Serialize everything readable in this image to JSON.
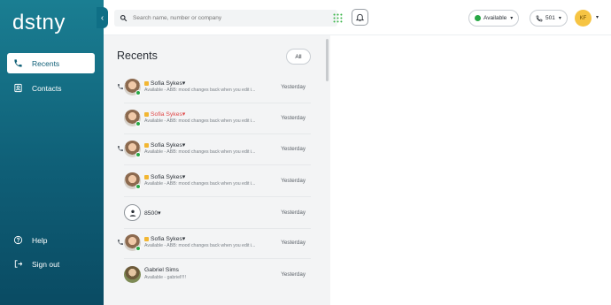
{
  "app": {
    "logo": "dstny",
    "collapse_icon": "‹"
  },
  "nav": {
    "items": [
      {
        "label": "Recents",
        "icon": "phone-icon"
      },
      {
        "label": "Contacts",
        "icon": "contacts-icon"
      }
    ],
    "bottom": [
      {
        "label": "Help",
        "icon": "help-icon"
      },
      {
        "label": "Sign out",
        "icon": "sign-out-icon"
      }
    ]
  },
  "topbar": {
    "search_placeholder": "Search name, number or company",
    "status_label": "Available",
    "extension_label": "501",
    "avatar_initials": "KF"
  },
  "recents": {
    "title": "Recents",
    "filter_label": "All",
    "rows": [
      {
        "name": "Sofia Sykes",
        "status": "Available - ABB: mood changes back when you edit i...",
        "time": "Yesterday",
        "missed": false
      },
      {
        "name": "Sofia Sykes",
        "status": "Available - ABB: mood changes back when you edit i...",
        "time": "Yesterday",
        "missed": true
      },
      {
        "name": "Sofia Sykes",
        "status": "Available - ABB: mood changes back when you edit i...",
        "time": "Yesterday",
        "missed": false
      },
      {
        "name": "Sofia Sykes",
        "status": "Available - ABB: mood changes back when you edit i...",
        "time": "Yesterday",
        "missed": false
      },
      {
        "name": "8500",
        "status": "",
        "time": "Yesterday",
        "missed": false
      },
      {
        "name": "Sofia Sykes",
        "status": "Available - ABB: mood changes back when you edit i...",
        "time": "Yesterday",
        "missed": false
      },
      {
        "name": "Gabriel Sims",
        "status": "Available - gabriel!!!!",
        "time": "Yesterday",
        "missed": false
      }
    ]
  },
  "colors": {
    "sidebar_top": "#1a7e92",
    "sidebar_bottom": "#0a4b63",
    "available": "#28a745",
    "missed": "#e04848",
    "favorite": "#f2b632",
    "avatar_kf": "#f6c443"
  }
}
